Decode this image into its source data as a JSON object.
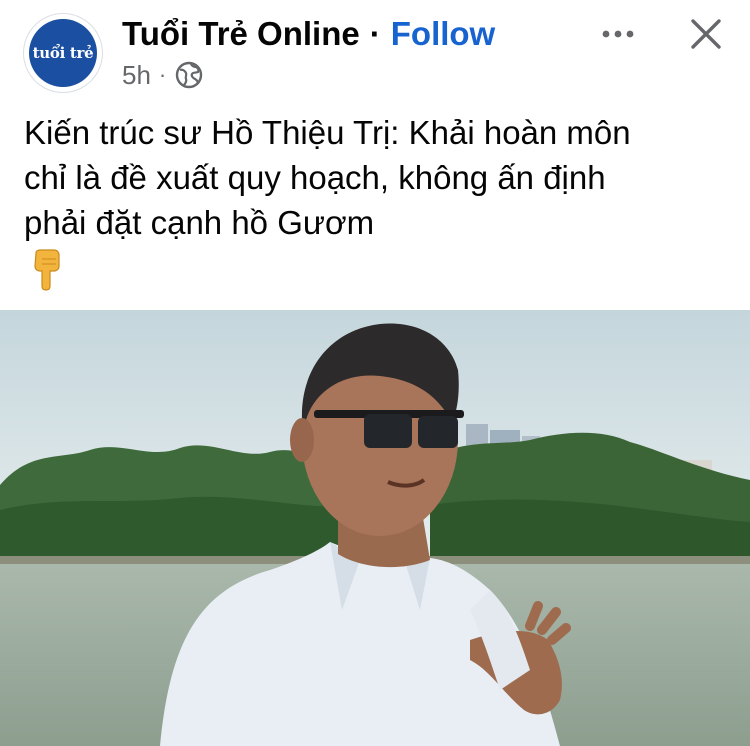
{
  "post": {
    "page_name": "Tuổi Trẻ Online",
    "separator": "·",
    "follow_label": "Follow",
    "avatar_text": "tuổi trẻ",
    "timestamp": "5h",
    "meta_separator": "·",
    "audience_icon": "globe-icon",
    "more_icon": "more-options-icon",
    "close_icon": "close-icon",
    "caption_lines": [
      "Kiến trúc sư Hồ Thiệu Trị: Khải hoàn môn",
      "chỉ là đề xuất quy hoạch, không ấn định",
      "phải đặt cạnh hồ Gươm"
    ],
    "caption_emoji": "backhand-index-pointing-down-icon",
    "photo": {
      "subject": "man-with-sunglasses-by-lake-photo"
    }
  },
  "colors": {
    "follow": "#1763cf",
    "meta_text": "#65676b",
    "avatar_bg": "#1b4fa2"
  }
}
